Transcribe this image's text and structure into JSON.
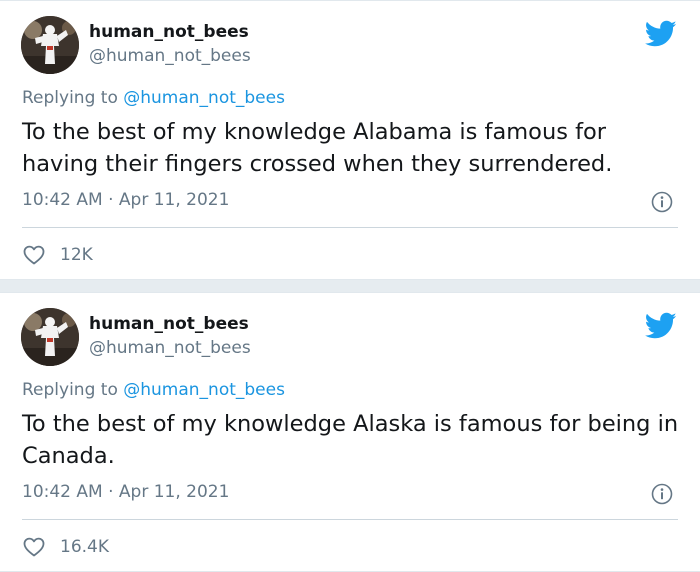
{
  "tweets": [
    {
      "display_name": "human_not_bees",
      "handle": "@human_not_bees",
      "replying_prefix": "Replying to",
      "replying_to": "@human_not_bees",
      "text": "To the best of my knowledge Alabama is famous for having their fingers crossed when they surrendered.",
      "timestamp": "10:42 AM · Apr 11, 2021",
      "likes": "12K"
    },
    {
      "display_name": "human_not_bees",
      "handle": "@human_not_bees",
      "replying_prefix": "Replying to",
      "replying_to": "@human_not_bees",
      "text": "To the best of my knowledge Alaska is famous for being in Canada.",
      "timestamp": "10:42 AM · Apr 11, 2021",
      "likes": "16.4K"
    }
  ],
  "icons": {
    "platform": "twitter-bird-icon",
    "info": "info-icon",
    "like": "heart-icon"
  },
  "colors": {
    "brand": "#1da1f2",
    "mention": "#1b95e0",
    "secondary_text": "#657786",
    "primary_text": "#14171a",
    "background": "#e6ecf0"
  }
}
